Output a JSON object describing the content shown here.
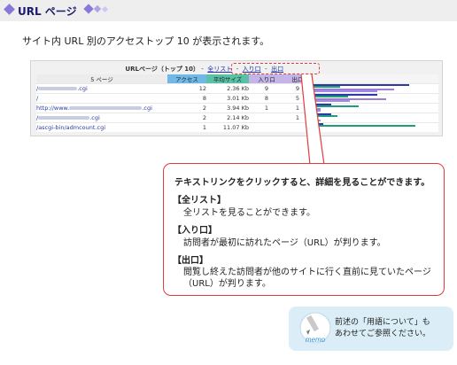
{
  "header": {
    "title": "URL ページ"
  },
  "intro": "サイト内 URL 別のアクセストップ 10 が表示されます。",
  "report": {
    "title": "URLページ（トップ 10）",
    "link_sep": "-",
    "links": [
      "全リスト",
      "入り口",
      "出口"
    ],
    "columns": {
      "page": "5 ページ",
      "access": "アクセス",
      "avg_size": "平均サイズ",
      "entry": "入り口",
      "exit": "出口"
    },
    "rows": [
      {
        "url_prefix": "/",
        "url_suffix": ".cgi",
        "access": "12",
        "avg_size": "2.36 Kb",
        "entry": "9",
        "exit": "9",
        "bars": {
          "access": 0.92,
          "size": 0.26,
          "entry": 0.78,
          "exit": 0.62
        }
      },
      {
        "url_prefix": "/",
        "url_suffix": "",
        "access": "8",
        "avg_size": "3.01 Kb",
        "entry": "8",
        "exit": "5",
        "bars": {
          "access": 0.62,
          "size": 0.34,
          "entry": 0.7,
          "exit": 0.36
        }
      },
      {
        "url_prefix": "http://www.",
        "url_suffix": ".cgi",
        "access": "2",
        "avg_size": "3.94 Kb",
        "entry": "1",
        "exit": "1",
        "bars": {
          "access": 0.18,
          "size": 0.44,
          "entry": 0.08,
          "exit": 0.08
        }
      },
      {
        "url_prefix": "/",
        "url_suffix": ".cgi",
        "access": "2",
        "avg_size": "2.14 Kb",
        "entry": "",
        "exit": "1",
        "bars": {
          "access": 0.18,
          "size": 0.24,
          "entry": 0,
          "exit": 0.08
        }
      },
      {
        "url_prefix": "/ascgi-bin/admcount.cgi",
        "url_suffix": "",
        "access": "1",
        "avg_size": "11.07 Kb",
        "entry": "",
        "exit": "",
        "bars": {
          "access": 0.1,
          "size": 0.98,
          "entry": 0,
          "exit": 0
        }
      }
    ]
  },
  "callout": {
    "heading": "テキストリンクをクリックすると、詳細を見ることができます。",
    "items": [
      {
        "term": "【全リスト】",
        "desc": [
          "全リストを見ることができます。"
        ]
      },
      {
        "term": "【入り口】",
        "desc": [
          "訪問者が最初に訪れたページ（URL）が判ります。"
        ]
      },
      {
        "term": "【出口】",
        "desc": [
          "閲覧し終えた訪問者が他のサイトに行く直前に見ていたページ",
          "（URL）が判ります。"
        ]
      }
    ]
  },
  "memo": {
    "icon_label": "memo",
    "lines": [
      "前述の「用語について」も",
      "あわせてご参照ください。"
    ]
  },
  "colors": {
    "diamond": "#8a78d6",
    "bar_access": "#2a3aa8",
    "bar_size": "#1f9e7a",
    "bar_entry": "#9a7fd8",
    "bar_exit": "#a48ae0",
    "callout_border": "#e23b3b"
  }
}
